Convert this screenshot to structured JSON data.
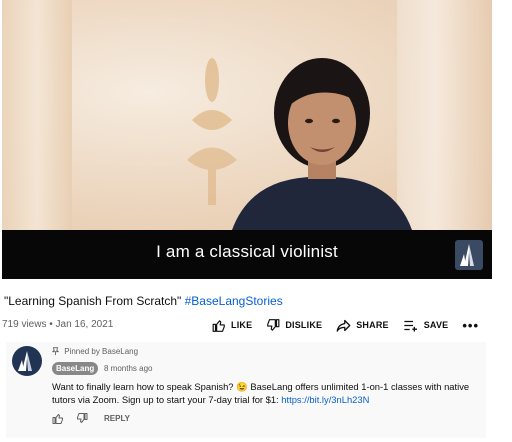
{
  "video": {
    "subtitle": "I am a classical violinist"
  },
  "title": {
    "main": "\"Learning Spanish From Scratch\"",
    "hashtag": "#BaseLangStories"
  },
  "meta": {
    "views_date": "719 views • Jan 16, 2021"
  },
  "actions": {
    "like": "LIKE",
    "dislike": "DISLIKE",
    "share": "SHARE",
    "save": "SAVE",
    "more": "•••"
  },
  "comment": {
    "pinned": "Pinned by BaseLang",
    "author": "BaseLang",
    "time": "8 months ago",
    "text": "Want to finally learn how to speak Spanish? 😉 BaseLang offers unlimited 1-on-1 classes with native tutors via Zoom. Sign up to start your 7-day trial for $1:",
    "link": "https://bit.ly/3nLh23N",
    "reply": "REPLY"
  },
  "icons": {
    "like": "thumbs-up-icon",
    "dislike": "thumbs-down-icon",
    "share": "share-icon",
    "save": "playlist-add-icon",
    "pin": "pin-icon"
  },
  "colors": {
    "link": "#065fd4",
    "avatar": "#213454"
  }
}
